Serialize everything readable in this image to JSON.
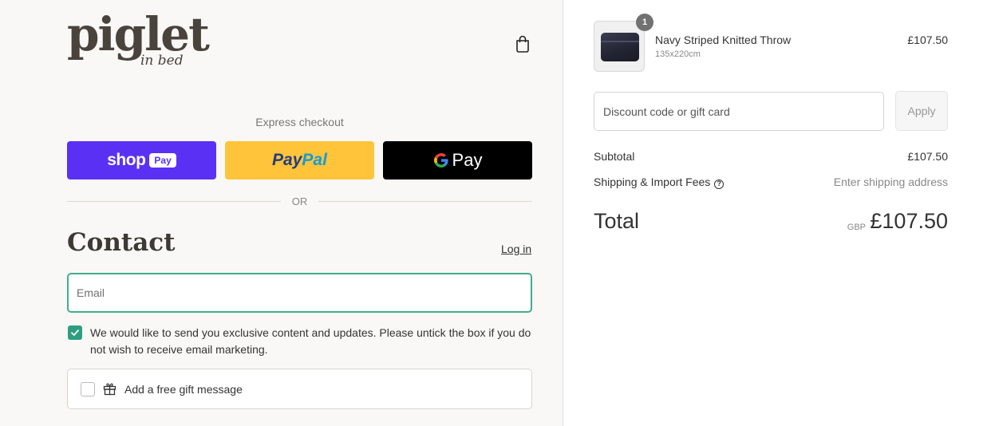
{
  "brand": {
    "logo_main": "piglet",
    "logo_sub": "in bed"
  },
  "header": {
    "cart_icon": "shopping-bag-icon"
  },
  "express": {
    "label": "Express checkout",
    "shop_pay": {
      "text": "shop",
      "pill": "Pay",
      "color": "#5a31f4"
    },
    "paypal": {
      "part1": "Pay",
      "part2": "Pal",
      "color": "#ffc439"
    },
    "gpay": {
      "text": "Pay",
      "color": "#000000"
    }
  },
  "divider": {
    "text": "OR"
  },
  "contact": {
    "title": "Contact",
    "login_label": "Log in",
    "email_placeholder": "Email",
    "marketing_checked": true,
    "marketing_text": "We would like to send you exclusive content and updates. Please untick the box if you do not wish to receive email marketing.",
    "gift_checked": false,
    "gift_icon": "gift-icon",
    "gift_label": "Add a free gift message"
  },
  "order": {
    "item": {
      "name": "Navy Striped Knitted Throw",
      "variant": "135x220cm",
      "price": "£107.50",
      "quantity": "1"
    },
    "discount_placeholder": "Discount code or gift card",
    "apply_label": "Apply",
    "subtotal_label": "Subtotal",
    "subtotal_value": "£107.50",
    "shipping_label": "Shipping & Import Fees",
    "shipping_value": "Enter shipping address",
    "total_label": "Total",
    "total_currency": "GBP",
    "total_value": "£107.50"
  },
  "colors": {
    "accent": "#3fae8c",
    "checkbox": "#2e9e80",
    "left_bg": "#f9f8f6"
  }
}
